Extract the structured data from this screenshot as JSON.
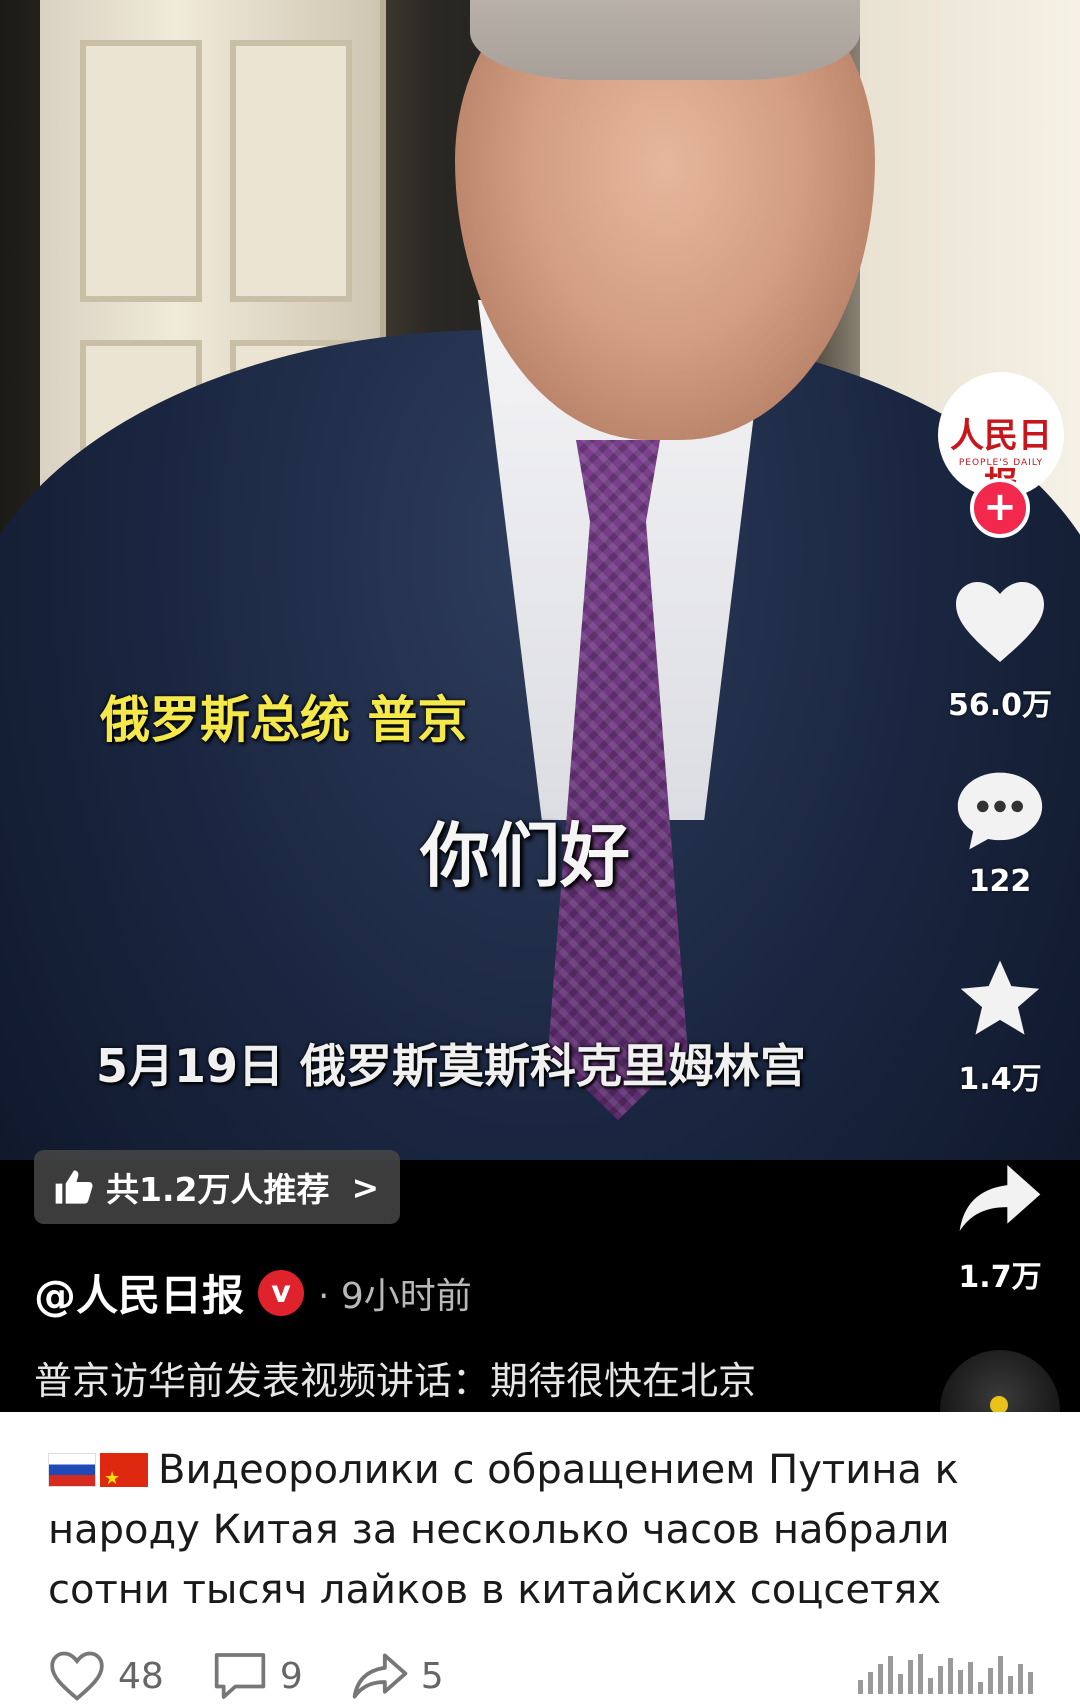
{
  "video": {
    "caption_name": "俄罗斯总统 普京",
    "caption_greeting": "你们好",
    "caption_date_place": "5月19日 俄罗斯莫斯科克里姆林宫",
    "avatar_logo_text": "人民日报",
    "avatar_logo_sub": "PEOPLE'S DAILY",
    "follow_symbol": "+",
    "like_count": "56.0万",
    "comment_count": "122",
    "favorite_count": "1.4万",
    "share_count": "1.7万",
    "recommend_text": "共1.2万人推荐",
    "recommend_chevron": ">",
    "author_handle": "@人民日报",
    "verified_mark": "v",
    "time_ago": "· 9小时前",
    "description": "普京访华前发表视频讲话：期待很快在北京"
  },
  "post": {
    "text": "Видеоролики с обращением Путина к народу Китая за несколько часов набрали сотни тысяч лайков в китайских соцсетях"
  },
  "footer": {
    "likes": "48",
    "comments": "9",
    "reposts": "5"
  },
  "colors": {
    "accent_red": "#f2284c",
    "verified_red": "#e0222c",
    "caption_yellow": "#f5e84a"
  }
}
